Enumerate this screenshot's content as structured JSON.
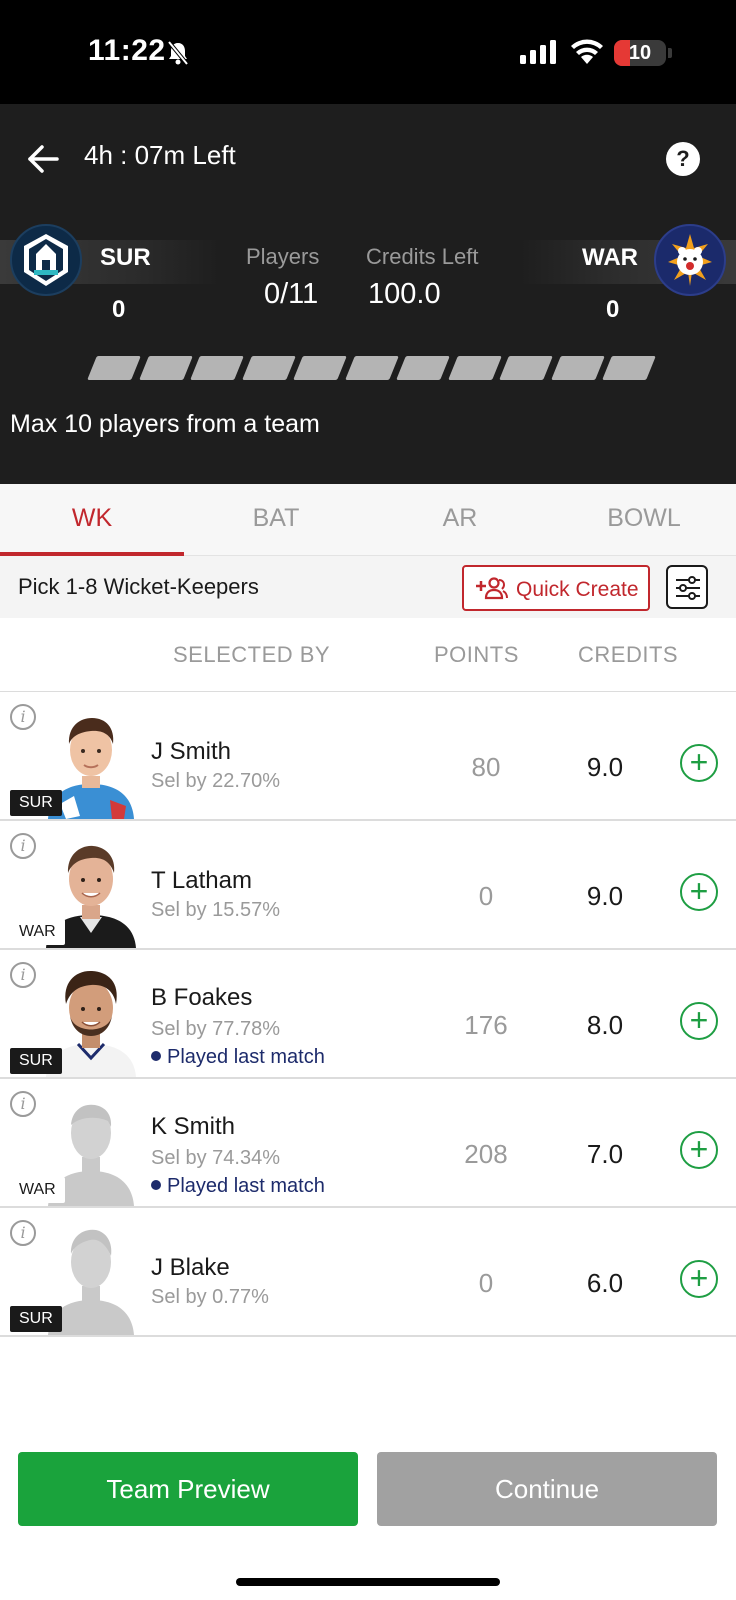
{
  "status_bar": {
    "time": "11:22",
    "battery_text": "10",
    "battery_level": 0.1,
    "icons": [
      "bell-slash-icon",
      "cellular-signal-icon",
      "wifi-icon",
      "battery-icon"
    ]
  },
  "header": {
    "time_left": "4h : 07m Left",
    "help_label": "?",
    "team_left": {
      "code": "SUR",
      "count": "0"
    },
    "team_right": {
      "code": "WAR",
      "count": "0"
    },
    "players_label": "Players",
    "players_value": "0/11",
    "credits_label": "Credits Left",
    "credits_value": "100.0",
    "slots_total": 11,
    "slots_filled": 0,
    "max_note": "Max 10 players from a team"
  },
  "tabs": [
    {
      "label": "WK",
      "active": true
    },
    {
      "label": "BAT",
      "active": false
    },
    {
      "label": "AR",
      "active": false
    },
    {
      "label": "BOWL",
      "active": false
    }
  ],
  "filter_bar": {
    "pick_label": "Pick 1-8 Wicket-Keepers",
    "quick_create_label": "Quick Create"
  },
  "columns": {
    "selected_by": "SELECTED BY",
    "points": "POINTS",
    "credits": "CREDITS"
  },
  "players": [
    {
      "name": "J Smith",
      "sel_by": "Sel by 22.70%",
      "points": "80",
      "credits": "9.0",
      "team": "SUR",
      "played_last": false,
      "note": "",
      "avatar": "photo"
    },
    {
      "name": "T Latham",
      "sel_by": "Sel by 15.57%",
      "points": "0",
      "credits": "9.0",
      "team": "WAR",
      "played_last": false,
      "note": "",
      "avatar": "photo"
    },
    {
      "name": "B Foakes",
      "sel_by": "Sel by 77.78%",
      "points": "176",
      "credits": "8.0",
      "team": "SUR",
      "played_last": true,
      "note": "Played last match",
      "avatar": "photo"
    },
    {
      "name": "K Smith",
      "sel_by": "Sel by 74.34%",
      "points": "208",
      "credits": "7.0",
      "team": "WAR",
      "played_last": true,
      "note": "Played last match",
      "avatar": "placeholder"
    },
    {
      "name": "J Blake",
      "sel_by": "Sel by 0.77%",
      "points": "0",
      "credits": "6.0",
      "team": "SUR",
      "played_last": false,
      "note": "",
      "avatar": "placeholder"
    }
  ],
  "footer": {
    "team_preview_label": "Team Preview",
    "continue_label": "Continue"
  },
  "colors": {
    "accent_red": "#c1272d",
    "green": "#1aa33c",
    "played_blue": "#1d2b6b"
  }
}
